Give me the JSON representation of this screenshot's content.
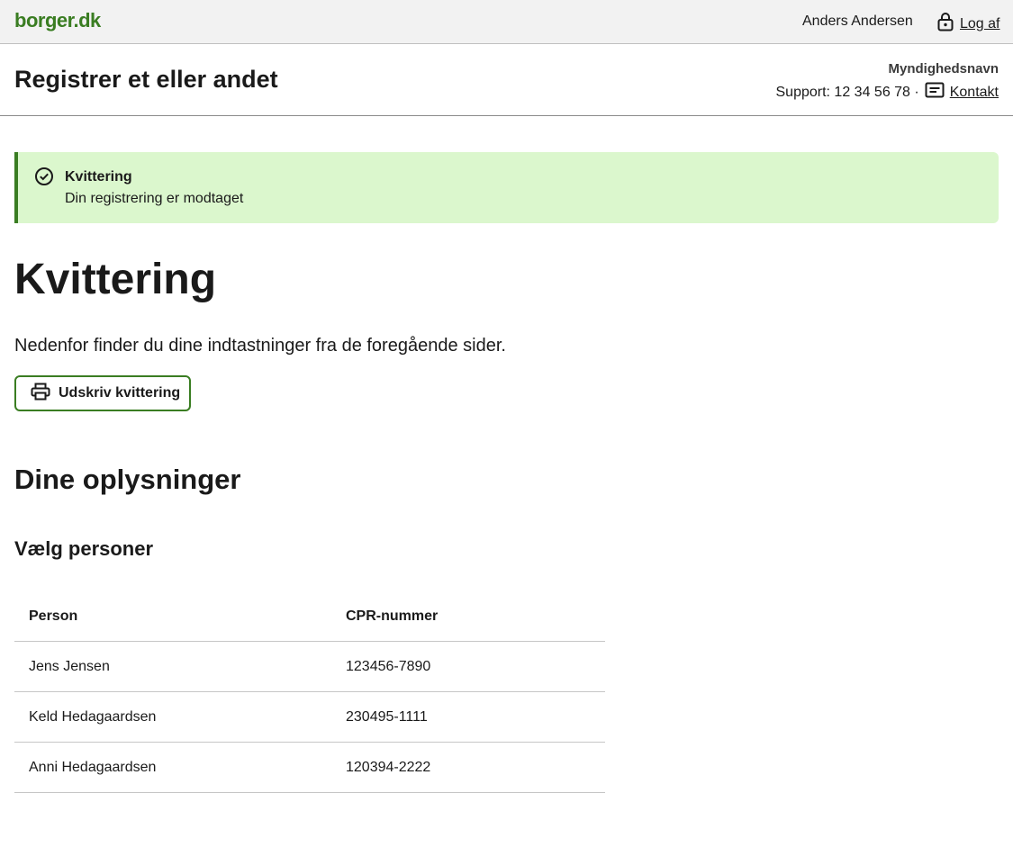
{
  "topbar": {
    "logo": "borger.dk",
    "user_name": "Anders Andersen",
    "logout_label": "Log af",
    "logout_icon": "lock-icon"
  },
  "header": {
    "title": "Registrer et eller andet",
    "authority": "Myndighedsnavn",
    "support": "Support: 12 34 56 78 ·",
    "contact_label": "Kontakt",
    "contact_icon": "message-icon"
  },
  "alert": {
    "icon": "check-circle-icon",
    "heading": "Kvittering",
    "text": "Din registrering er modtaget"
  },
  "main": {
    "title": "Kvittering",
    "lead": "Nedenfor finder du dine indtastninger fra de foregående sider.",
    "print_label": "Udskriv kvittering",
    "print_icon": "printer-icon",
    "section_title": "Dine oplysninger",
    "sub_title": "Vælg personer"
  },
  "table": {
    "headers": [
      "Person",
      "CPR-nummer"
    ],
    "rows": [
      [
        "Jens Jensen",
        "123456-7890"
      ],
      [
        "Keld Hedagaardsen",
        "230495-1111"
      ],
      [
        "Anni Hedagaardsen",
        "120394-2222"
      ]
    ]
  },
  "colors": {
    "brand_green": "#3a7d22",
    "success_bg": "#dbf7cd",
    "topbar_bg": "#f2f2f2"
  }
}
